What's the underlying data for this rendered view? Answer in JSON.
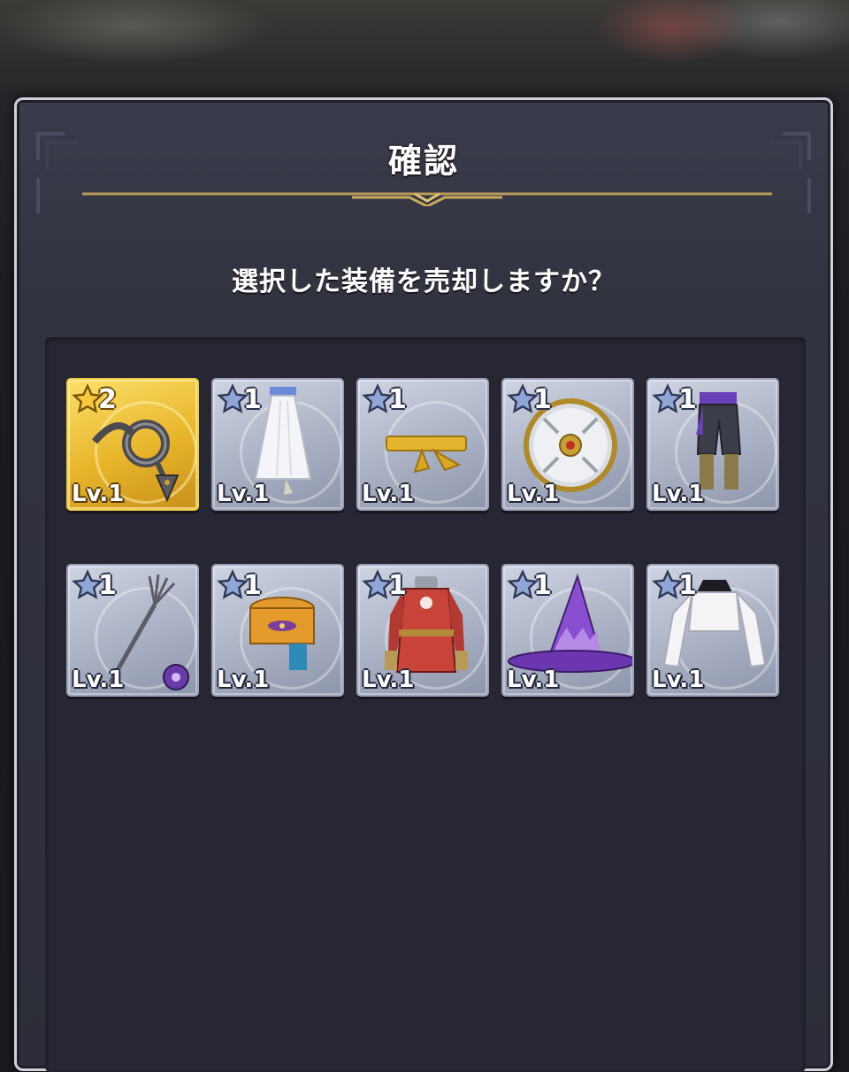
{
  "dialog": {
    "title": "確認",
    "message": "選択した装備を売却しますか？"
  },
  "items": [
    {
      "rarity": "2",
      "level": "Lv.1",
      "icon": "whip-icon",
      "highlight": true
    },
    {
      "rarity": "1",
      "level": "Lv.1",
      "icon": "skirt-icon",
      "highlight": false
    },
    {
      "rarity": "1",
      "level": "Lv.1",
      "icon": "sash-belt-icon",
      "highlight": false
    },
    {
      "rarity": "1",
      "level": "Lv.1",
      "icon": "round-shield-icon",
      "highlight": false
    },
    {
      "rarity": "1",
      "level": "Lv.1",
      "icon": "pants-icon",
      "highlight": false
    },
    {
      "rarity": "1",
      "level": "Lv.1",
      "icon": "fork-icon",
      "highlight": false,
      "badge": "purple-orb-badge"
    },
    {
      "rarity": "1",
      "level": "Lv.1",
      "icon": "headband-icon",
      "highlight": false
    },
    {
      "rarity": "1",
      "level": "Lv.1",
      "icon": "red-robe-icon",
      "highlight": false
    },
    {
      "rarity": "1",
      "level": "Lv.1",
      "icon": "witch-hat-icon",
      "highlight": false
    },
    {
      "rarity": "1",
      "level": "Lv.1",
      "icon": "white-hoodie-icon",
      "highlight": false
    }
  ]
}
